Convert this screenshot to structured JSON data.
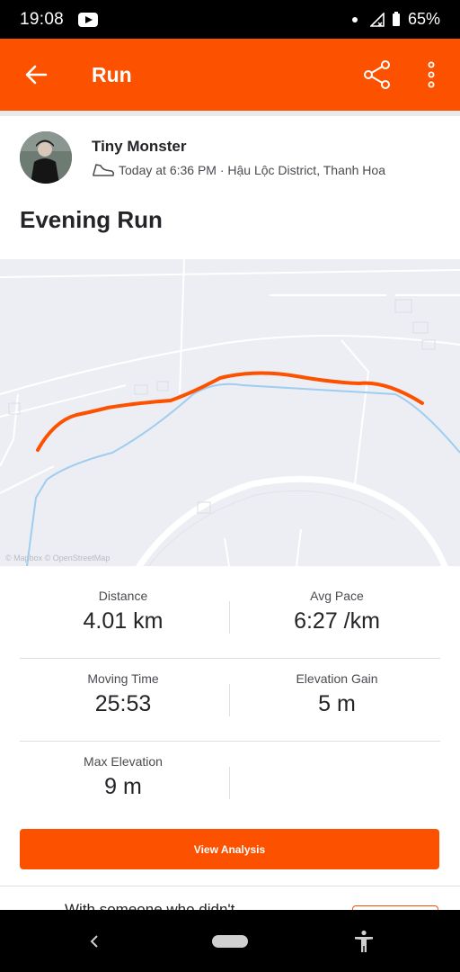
{
  "status_bar": {
    "time": "19:08",
    "battery": "65%"
  },
  "app_bar": {
    "title": "Run"
  },
  "athlete": {
    "name": "Tiny Monster",
    "meta": "Today at 6:36 PM · Hậu Lộc District, Thanh Hoa"
  },
  "activity": {
    "title": "Evening Run"
  },
  "map": {
    "credit": "© Mapbox © OpenStreetMap"
  },
  "stats": [
    {
      "label": "Distance",
      "value": "4.01 km"
    },
    {
      "label": "Avg Pace",
      "value": "6:27 /km"
    },
    {
      "label": "Moving Time",
      "value": "25:53"
    },
    {
      "label": "Elevation Gain",
      "value": "5 m"
    },
    {
      "label": "Max Elevation",
      "value": "9 m"
    }
  ],
  "actions": {
    "view_analysis": "View Analysis"
  },
  "peek": {
    "text": "With someone who didn't"
  },
  "colors": {
    "brand": "#fc5200",
    "route": "#fc5200",
    "river": "#9fcdf0"
  }
}
